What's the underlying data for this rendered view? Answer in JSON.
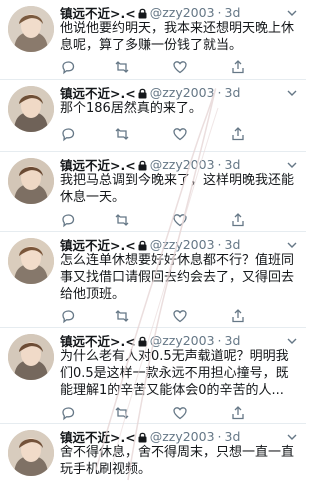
{
  "tweets": [
    {
      "name": "镇远不近>.<",
      "handle": "@zzy2003",
      "dot": "·",
      "time": "3d",
      "text": "他说他要约明天，我本来还想明天晚上休息呢，算了多赚一份钱了就当。"
    },
    {
      "name": "镇远不近>.<",
      "handle": "@zzy2003",
      "dot": "·",
      "time": "3d",
      "text": "那个186居然真的来了。"
    },
    {
      "name": "镇远不近>.<",
      "handle": "@zzy2003",
      "dot": "·",
      "time": "3d",
      "text": "我把马总调到今晚来了，这样明晚我还能休息一天。"
    },
    {
      "name": "镇远不近>.<",
      "handle": "@zzy2003",
      "dot": "·",
      "time": "3d",
      "text": "怎么连单休想要好好休息都不行？值班同事又找借口请假回去约会去了，又得回去给他顶班。"
    },
    {
      "name": "镇远不近>.<",
      "handle": "@zzy2003",
      "dot": "·",
      "time": "3d",
      "text": "为什么老有人对0.5无声载道呢？明明我们0.5是这样一款永远不用担心撞号，既能理解1的辛苦又能体会0的辛苦的人..."
    },
    {
      "name": "镇远不近>.<",
      "handle": "@zzy2003",
      "dot": "·",
      "time": "3d",
      "text": "舍不得休息，舍不得周末，只想一直一直玩手机刷视频。"
    }
  ],
  "colors": {
    "text": "#14171a",
    "secondary": "#657786",
    "divider": "#e6ecf0"
  },
  "icons": [
    "lock-icon",
    "chevron-down-icon",
    "reply-icon",
    "retweet-icon",
    "like-icon",
    "share-icon"
  ]
}
